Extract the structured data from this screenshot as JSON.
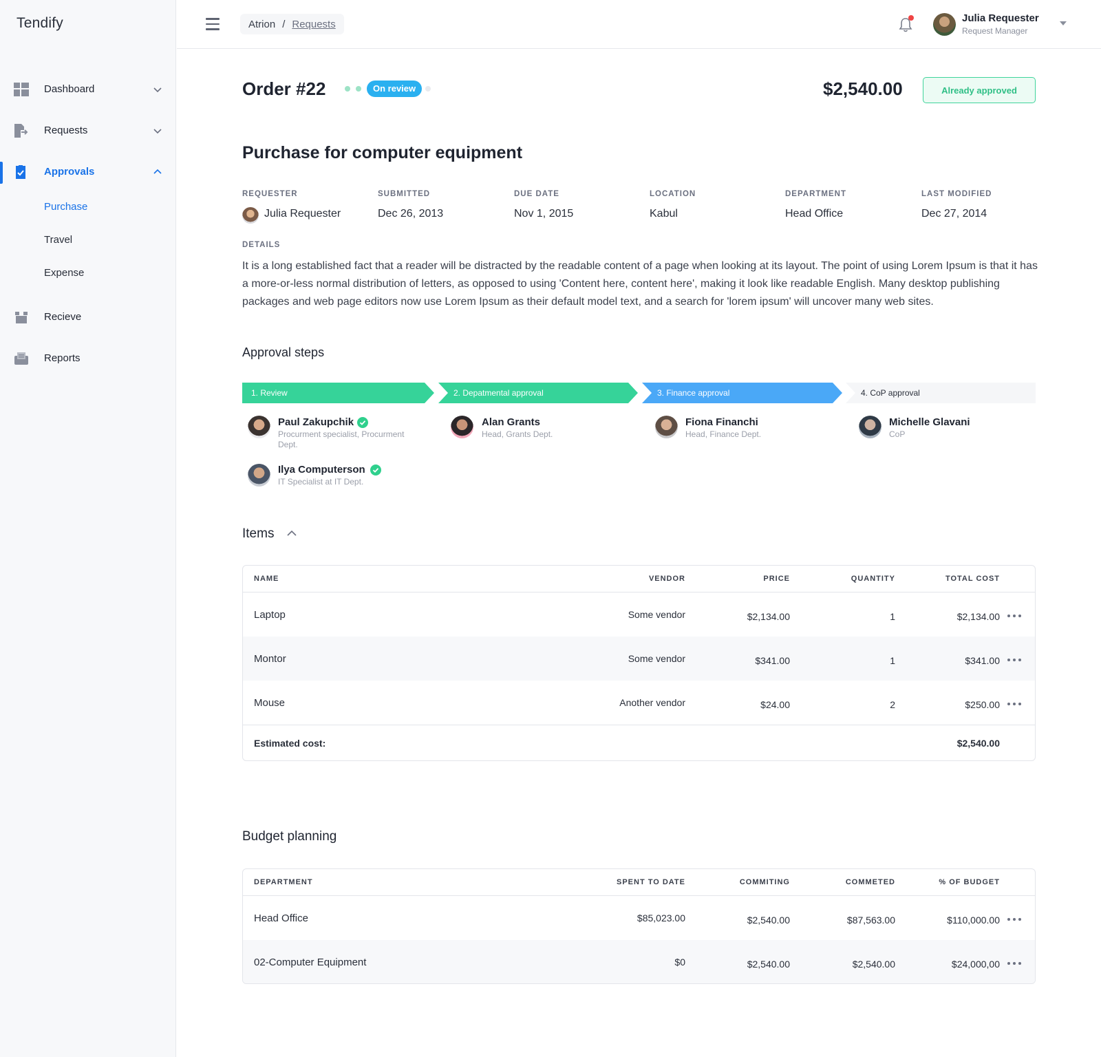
{
  "app": {
    "name": "Tendify"
  },
  "sidebar": {
    "items": [
      {
        "label": "Dashboard",
        "icon": "dashboard-icon"
      },
      {
        "label": "Requests",
        "icon": "requests-icon"
      },
      {
        "label": "Approvals",
        "icon": "approvals-icon",
        "active": true
      },
      {
        "label": "Recieve",
        "icon": "receive-box-icon"
      },
      {
        "label": "Reports",
        "icon": "reports-icon"
      }
    ],
    "approvals_sub": [
      {
        "label": "Purchase",
        "active": true
      },
      {
        "label": "Travel"
      },
      {
        "label": "Expense"
      }
    ]
  },
  "header": {
    "breadcrumb": {
      "root": "Atrion",
      "separator": "/",
      "current": "Requests"
    },
    "user": {
      "name": "Julia Requester",
      "role": "Request Manager"
    },
    "notification_dot_color": "#ef4444"
  },
  "order": {
    "title": "Order #22",
    "status": "On review",
    "total": "$2,540.00",
    "approve_label": "Already approved"
  },
  "request": {
    "heading": "Purchase for computer equipment",
    "meta": [
      {
        "label": "REQUESTER",
        "value": "Julia Requester"
      },
      {
        "label": "SUBMITTED",
        "value": "Dec 26, 2013"
      },
      {
        "label": "DUE DATE",
        "value": "Nov 1, 2015"
      },
      {
        "label": "LOCATION",
        "value": "Kabul"
      },
      {
        "label": "DEPARTMENT",
        "value": "Head Office"
      },
      {
        "label": "LAST MODIFIED",
        "value": "Dec 27, 2014"
      }
    ],
    "details_label": "DETAILS",
    "details": "It is a long established fact that a reader will be distracted by the readable content of a page when looking at its layout. The point of using Lorem Ipsum is that it has a more-or-less normal distribution of letters, as opposed to using 'Content here, content here', making it look like readable English. Many desktop publishing packages and web page editors now use Lorem Ipsum as their default model text, and a search for 'lorem ipsum' will uncover many web sites."
  },
  "approval": {
    "title": "Approval steps",
    "steps": [
      {
        "label": "1. Review",
        "state": "done",
        "color": "#36d399"
      },
      {
        "label": "2. Depatmental approval",
        "state": "done",
        "color": "#36d399"
      },
      {
        "label": "3. Finance approval",
        "state": "current",
        "color": "#4aa8f7"
      },
      {
        "label": "4. CoP approval",
        "state": "pending",
        "color": "#f5f6f8"
      }
    ],
    "approvers": [
      {
        "name": "Paul Zakupchik",
        "role": "Procurment specialist, Procurment Dept.",
        "approved": true
      },
      {
        "name": "Ilya Computerson",
        "role": "IT Specialist at IT Dept.",
        "approved": true
      },
      {
        "name": "Alan Grants",
        "role": "Head, Grants Dept.",
        "approved": false
      },
      {
        "name": "Fiona Financhi",
        "role": "Head, Finance Dept.",
        "approved": false
      },
      {
        "name": "Michelle Glavani",
        "role": "CoP",
        "approved": false
      }
    ]
  },
  "items": {
    "title": "Items",
    "columns": [
      "NAME",
      "VENDOR",
      "PRICE",
      "QUANTITY",
      "TOTAL COST"
    ],
    "rows": [
      {
        "name": "Laptop",
        "vendor": "Some vendor",
        "price": "$2,134.00",
        "quantity": "1",
        "total": "$2,134.00"
      },
      {
        "name": "Montor",
        "vendor": "Some vendor",
        "price": "$341.00",
        "quantity": "1",
        "total": "$341.00"
      },
      {
        "name": "Mouse",
        "vendor": "Another vendor",
        "price": "$24.00",
        "quantity": "2",
        "total": "$250.00"
      }
    ],
    "footer_label": "Estimated cost:",
    "footer_total": "$2,540.00"
  },
  "budget": {
    "title": "Budget planning",
    "columns": [
      "DEPARTMENT",
      "SPENT TO DATE",
      "COMMITING",
      "COMMETED",
      "% OF BUDGET"
    ],
    "rows": [
      {
        "department": "Head Office",
        "spent": "$85,023.00",
        "commiting": "$2,540.00",
        "commeted": "$87,563.00",
        "budget": "$110,000.00"
      },
      {
        "department": "02-Computer Equipment",
        "spent": "$0",
        "commiting": "$2,540.00",
        "commeted": "$2,540.00",
        "budget": "$24,000,00"
      }
    ]
  },
  "colors": {
    "accent": "#1a73e8",
    "success": "#36d399",
    "info": "#4aa8f7"
  }
}
